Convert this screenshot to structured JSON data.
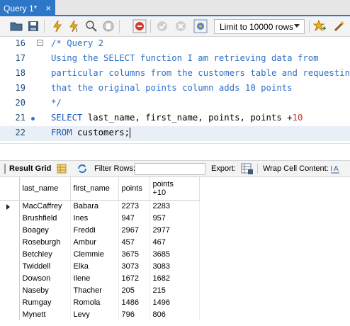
{
  "tab": {
    "title": "Query 1*",
    "close": "×"
  },
  "toolbar": {
    "limit_label": "Limit to 10000 rows"
  },
  "editor": {
    "lines": [
      {
        "num": "16",
        "text": "/* Query 2"
      },
      {
        "num": "17",
        "text": "Using the SELECT function I am retrieving data from"
      },
      {
        "num": "18",
        "text": "particular columns from the customers table and requesting"
      },
      {
        "num": "19",
        "text": "that the original points column adds 10 points"
      },
      {
        "num": "20",
        "text": "*/"
      },
      {
        "num": "21",
        "kw": "SELECT",
        "rest": " last_name, first_name, points, points +",
        "n": "10"
      },
      {
        "num": "22",
        "kw": "FROM",
        "rest": " customers;"
      }
    ]
  },
  "resultbar": {
    "result_grid": "Result Grid",
    "filter_rows": "Filter Rows:",
    "export": "Export:",
    "wrap": "Wrap Cell Content:"
  },
  "grid": {
    "columns": [
      "last_name",
      "first_name",
      "points",
      "points\n+10"
    ],
    "rows": [
      [
        "MacCaffrey",
        "Babara",
        "2273",
        "2283"
      ],
      [
        "Brushfield",
        "Ines",
        "947",
        "957"
      ],
      [
        "Boagey",
        "Freddi",
        "2967",
        "2977"
      ],
      [
        "Roseburgh",
        "Ambur",
        "457",
        "467"
      ],
      [
        "Betchley",
        "Clemmie",
        "3675",
        "3685"
      ],
      [
        "Twiddell",
        "Elka",
        "3073",
        "3083"
      ],
      [
        "Dowson",
        "Ilene",
        "1672",
        "1682"
      ],
      [
        "Naseby",
        "Thacher",
        "205",
        "215"
      ],
      [
        "Rumgay",
        "Romola",
        "1486",
        "1496"
      ],
      [
        "Mynett",
        "Levy",
        "796",
        "806"
      ]
    ]
  },
  "colors": {
    "accent": "#2d77c9",
    "comment": "#2d6fc7",
    "keyword": "#1f58b8",
    "number": "#c2352b"
  }
}
